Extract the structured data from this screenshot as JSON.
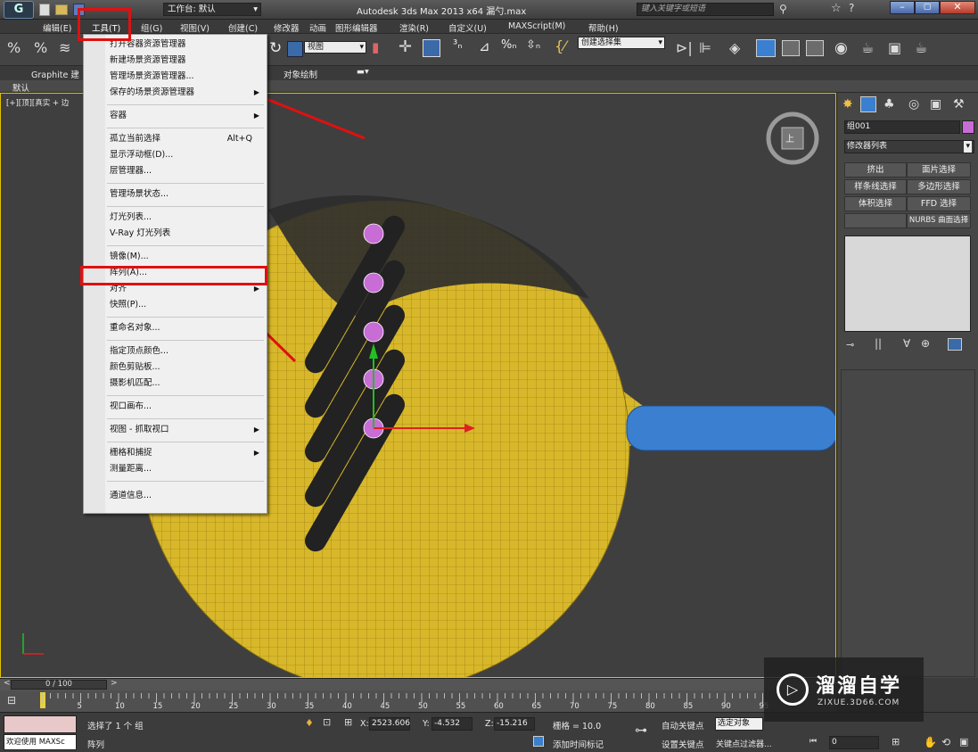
{
  "window": {
    "title": "Autodesk 3ds Max  2013 x64     漏勺.max",
    "workspace_label": "工作台: 默认",
    "search_placeholder": "键入关键字或短语"
  },
  "menubar": [
    "编辑(E)",
    "工具(T)",
    "组(G)",
    "视图(V)",
    "创建(C)",
    "修改器",
    "动画",
    "图形编辑器",
    "渲染(R)",
    "自定义(U)",
    "MAXScript(M)",
    "帮助(H)"
  ],
  "toolbar": {
    "view_dropdown": "视图",
    "selection_set_dropdown": "创建选择集"
  },
  "ribbon": {
    "graphite_label": "Graphite 建",
    "object_paint_label": "对象绘制",
    "default_label": "默认"
  },
  "viewport": {
    "label": "[+][顶][真实 + 边",
    "cube_label": "上"
  },
  "tools_menu": {
    "items": [
      {
        "label": "打开容器资源管理器",
        "shortcut": "",
        "submenu": false
      },
      {
        "label": "新建场景资源管理器",
        "shortcut": "",
        "submenu": false
      },
      {
        "label": "管理场景资源管理器...",
        "shortcut": "",
        "submenu": false
      },
      {
        "label": "保存的场景资源管理器",
        "shortcut": "",
        "submenu": true
      },
      {
        "label": "容器",
        "shortcut": "",
        "submenu": true
      },
      {
        "label": "孤立当前选择",
        "shortcut": "Alt+Q",
        "submenu": false
      },
      {
        "label": "显示浮动框(D)...",
        "shortcut": "",
        "submenu": false
      },
      {
        "label": "层管理器...",
        "shortcut": "",
        "submenu": false
      },
      {
        "label": "管理场景状态...",
        "shortcut": "",
        "submenu": false
      },
      {
        "label": "灯光列表...",
        "shortcut": "",
        "submenu": false
      },
      {
        "label": "V-Ray 灯光列表",
        "shortcut": "",
        "submenu": false
      },
      {
        "label": "镜像(M)...",
        "shortcut": "",
        "submenu": false
      },
      {
        "label": "阵列(A)...",
        "shortcut": "",
        "submenu": false
      },
      {
        "label": "对齐",
        "shortcut": "",
        "submenu": true
      },
      {
        "label": "快照(P)...",
        "shortcut": "",
        "submenu": false
      },
      {
        "label": "重命名对象...",
        "shortcut": "",
        "submenu": false
      },
      {
        "label": "指定顶点颜色...",
        "shortcut": "",
        "submenu": false
      },
      {
        "label": "颜色剪贴板...",
        "shortcut": "",
        "submenu": false
      },
      {
        "label": "摄影机匹配...",
        "shortcut": "",
        "submenu": false
      },
      {
        "label": "视口画布...",
        "shortcut": "",
        "submenu": false
      },
      {
        "label": "视图 - 抓取视口",
        "shortcut": "",
        "submenu": true
      },
      {
        "label": "栅格和捕捉",
        "shortcut": "",
        "submenu": true
      },
      {
        "label": "测量距离...",
        "shortcut": "",
        "submenu": false
      },
      {
        "label": "通道信息...",
        "shortcut": "",
        "submenu": false
      }
    ]
  },
  "command_panel": {
    "object_name": "组001",
    "modifier_list": "修改器列表",
    "buttons": [
      "挤出",
      "面片选择",
      "样条线选择",
      "多边形选择",
      "体积选择",
      "FFD 选择",
      "",
      "NURBS 曲面选择"
    ]
  },
  "timeline": {
    "frame_display": "0 / 100",
    "ticks": [
      "5",
      "10",
      "15",
      "20",
      "25",
      "30",
      "35",
      "40",
      "45",
      "50",
      "55",
      "60",
      "65",
      "70",
      "75",
      "80",
      "85",
      "90",
      "95"
    ]
  },
  "status": {
    "selection_text": "选择了 1 个 组",
    "maxscript_label": "欢迎使用 MAXSc",
    "prompt_text": "阵列",
    "x_label": "X:",
    "x_value": "2523.606",
    "y_label": "Y:",
    "y_value": "-4.532",
    "z_label": "Z:",
    "z_value": "-15.216",
    "grid_label": "栅格 = 10.0",
    "add_time_tag": "添加时间标记",
    "auto_key": "自动关键点",
    "set_key": "设置关键点",
    "selected_dropdown": "选定对象",
    "key_filters": "关键点过滤器...",
    "frame_value": "0"
  },
  "watermark": {
    "title": "溜溜自学",
    "url": "ZIXUE.3D66.COM"
  },
  "colors": {
    "highlight_red": "#e01010",
    "mesh_yellow": "#d8b82a",
    "handle_blue": "#3a7fd0",
    "gizmo_purple": "#c86cd6"
  }
}
